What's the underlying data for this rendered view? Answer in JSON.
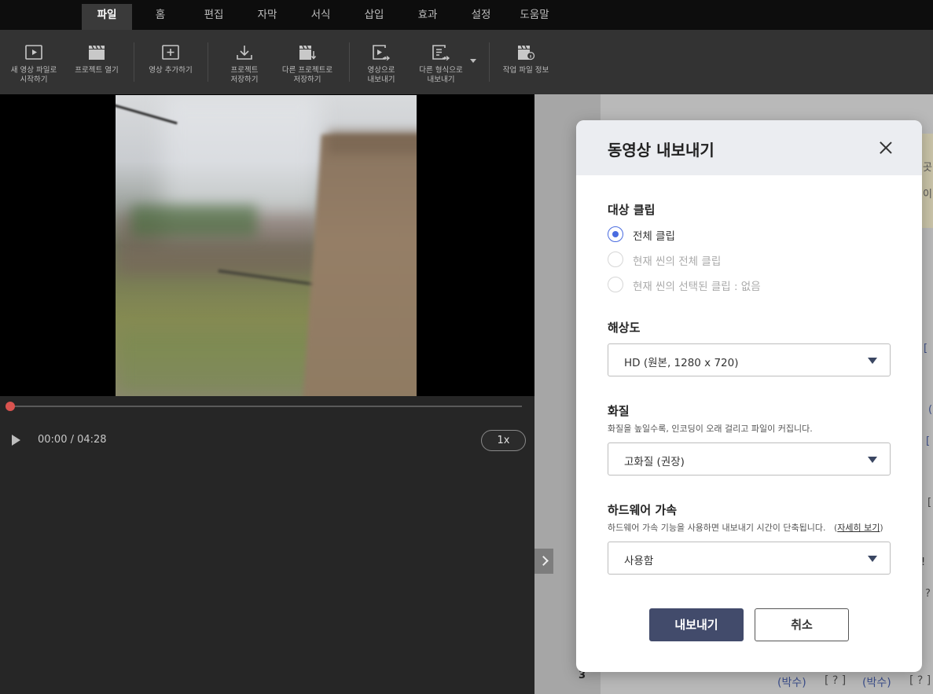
{
  "menu": {
    "tabs": [
      {
        "label": "파일",
        "active": true
      },
      {
        "label": "홈"
      },
      {
        "label": "편집"
      },
      {
        "label": "자막"
      },
      {
        "label": "서식"
      },
      {
        "label": "삽입"
      },
      {
        "label": "효과"
      },
      {
        "label": "설정"
      },
      {
        "label": "도움말"
      }
    ]
  },
  "toolbar": {
    "items": [
      {
        "label": "새 영상 파일로\n시작하기",
        "icon": "play-box-icon"
      },
      {
        "label": "프로젝트 열기",
        "icon": "clapperboard-icon"
      },
      {
        "label": "영상 추가하기",
        "icon": "add-box-icon"
      },
      {
        "label": "프로젝트\n저장하기",
        "icon": "download-icon"
      },
      {
        "label": "다른 프로젝트로\n저장하기",
        "icon": "clapperboard-down-icon"
      },
      {
        "label": "영상으로\n내보내기",
        "icon": "export-video-icon"
      },
      {
        "label": "다른 형식으로\n내보내기",
        "icon": "export-format-icon"
      },
      {
        "label": "작업 파일 정보",
        "icon": "clapperboard-info-icon"
      }
    ]
  },
  "player": {
    "time": "00:00 / 04:28",
    "speed": "1x",
    "progress": 0
  },
  "side": {
    "fragments": [
      "곳",
      "이",
      "[",
      "(",
      "[",
      "[",
      "!",
      "?"
    ],
    "row_number": "3",
    "bottom_row": [
      "(박수)",
      "[ ? ]",
      "(박수)",
      "[ ? ]"
    ]
  },
  "dialog": {
    "title": "동영상 내보내기",
    "target": {
      "title": "대상 클립",
      "options": [
        {
          "label": "전체 클립",
          "selected": true,
          "enabled": true
        },
        {
          "label": "현재 씬의 전체 클립",
          "selected": false,
          "enabled": false
        },
        {
          "label": "현재 씬의 선택된 클립 : 없음",
          "selected": false,
          "enabled": false
        }
      ]
    },
    "resolution": {
      "title": "해상도",
      "value": "HD (원본, 1280 x 720)"
    },
    "quality": {
      "title": "화질",
      "desc": "화질을 높일수록, 인코딩이 오래 걸리고 파일이 커집니다.",
      "value": "고화질 (권장)"
    },
    "hw": {
      "title": "하드웨어 가속",
      "desc": "하드웨어 가속 기능을 사용하면 내보내기 시간이 단축됩니다.",
      "link": "자세히 보기",
      "value": "사용함"
    },
    "export_label": "내보내기",
    "cancel_label": "취소"
  },
  "colors": {
    "accent": "#4a6ce0",
    "primary_button": "#424b6b",
    "scrubber": "#d9534f"
  }
}
